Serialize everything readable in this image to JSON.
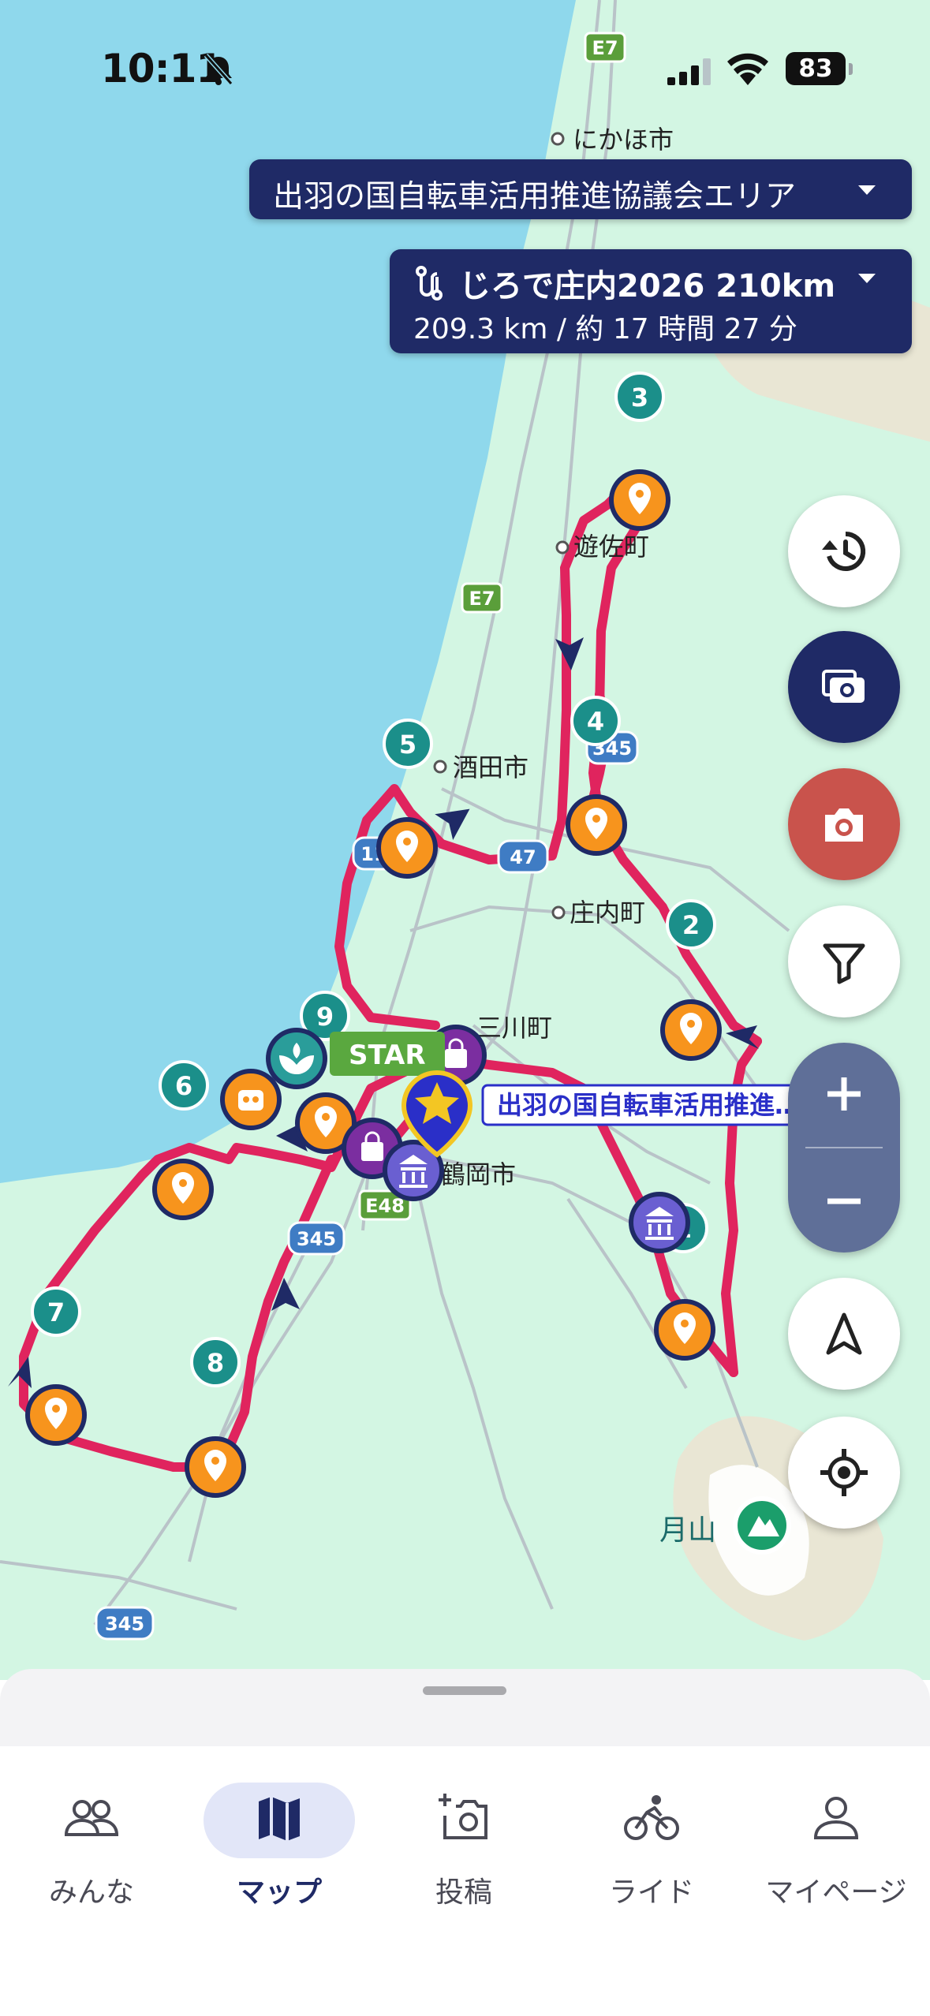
{
  "status_bar": {
    "time": "10:11",
    "battery": "83",
    "icons": [
      "bell-slash-icon",
      "cellular-signal-icon",
      "wifi-icon",
      "battery-icon"
    ]
  },
  "map": {
    "place_labels": {
      "nikaho": "にかほ市",
      "yuza": "遊佐町",
      "sakata": "酒田市",
      "shonai": "庄内町",
      "mikawa": "三川町",
      "tsuruoka": "鶴岡市",
      "gassan": "月山"
    },
    "road_shields": {
      "e7_top": "E7",
      "e7_mid": "E7",
      "r345_a": "345",
      "r47": "47",
      "r112": "11",
      "e48": "E48",
      "r345_b": "345",
      "r345_c": "345"
    },
    "checkpoints": [
      "1",
      "2",
      "3",
      "4",
      "5",
      "6",
      "7",
      "8",
      "9"
    ],
    "start_label": "STAR",
    "area_callout": "出羽の国自転車活用推進…",
    "colors": {
      "sea": "#8fd8ec",
      "land": "#d3f6e3",
      "route": "#e0245e",
      "checkpoint": "#1b8f8a",
      "poi_orange": "#f7941d",
      "poi_navy": "#1f2a66",
      "poi_purple": "#7b2ea0",
      "shield_green": "#5a9e3a",
      "shield_blue": "#3f7cc4"
    }
  },
  "area_dropdown": {
    "label": "出羽の国自転車活用推進協議会エリア"
  },
  "route_dropdown": {
    "name": "じろで庄内2026 210km",
    "stats": "209.3 km / 約 17 時間 27 分"
  },
  "map_controls": {
    "history": "history-icon",
    "photo_upload": "photo-upload-icon",
    "camera": "camera-icon",
    "filter": "filter-icon",
    "zoom_in": "+",
    "zoom_out": "−",
    "navigate": "navigation-arrow-icon",
    "locate": "crosshair-locate-icon"
  },
  "bottom_nav": {
    "items": [
      {
        "label": "みんな",
        "icon": "people-icon"
      },
      {
        "label": "マップ",
        "icon": "map-icon",
        "active": true
      },
      {
        "label": "投稿",
        "icon": "add-photo-icon"
      },
      {
        "label": "ライド",
        "icon": "bicycle-icon"
      },
      {
        "label": "マイページ",
        "icon": "person-icon"
      }
    ]
  }
}
